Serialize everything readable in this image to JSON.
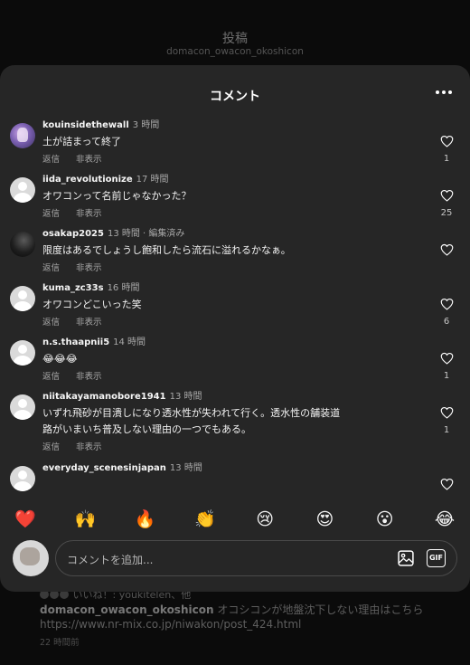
{
  "background": {
    "title": "投稿",
    "subtitle": "domacon_owacon_okoshicon",
    "likes_text": "いいね！: youkitelen、他",
    "caption_user": "domacon_owacon_okoshicon",
    "caption_text": " オコシコンが地盤沈下しない理由はこちら https://www.nr-mix.co.jp/niwakon/post_424.html",
    "time": "22 時間前"
  },
  "sheet": {
    "title": "コメント"
  },
  "actions": {
    "reply": "返信",
    "hide": "非表示"
  },
  "comments": [
    {
      "user": "kouinsidethewall",
      "time": "3 時間",
      "text": "土が詰まって終了",
      "likes": "1"
    },
    {
      "user": "iida_revolutionize",
      "time": "17 時間",
      "text": "オワコンって名前じゃなかった？",
      "likes": "25"
    },
    {
      "user": "osakap2025",
      "time": "13 時間 · 編集済み",
      "text": "限度はあるでしょうし飽和したら流石に溢れるかなぁ。",
      "likes": ""
    },
    {
      "user": "kuma_zc33s",
      "time": "16 時間",
      "text": "オワコンどこいった笑",
      "likes": "6"
    },
    {
      "user": "n.s.thaapnii5",
      "time": "14 時間",
      "text": "😂😂😂",
      "likes": "1"
    },
    {
      "user": "niitakayamanobore1941",
      "time": "13 時間",
      "text": "いずれ飛砂が目潰しになり透水性が失われて行く。透水性の舗装道路がいまいち普及しない理由の一つでもある。",
      "likes": "1"
    },
    {
      "user": "everyday_scenesinjapan",
      "time": "13 時間",
      "text": "",
      "likes": ""
    }
  ],
  "emoji_bar": [
    "❤️",
    "🙌",
    "🔥",
    "👏",
    "😢",
    "😍",
    "😮",
    "😂"
  ],
  "input": {
    "placeholder": "コメントを追加...",
    "gif_label": "GIF"
  },
  "icons": {
    "more": "more-horizontal-icon",
    "like": "heart-outline-icon",
    "image": "image-icon",
    "gif": "gif-icon"
  }
}
